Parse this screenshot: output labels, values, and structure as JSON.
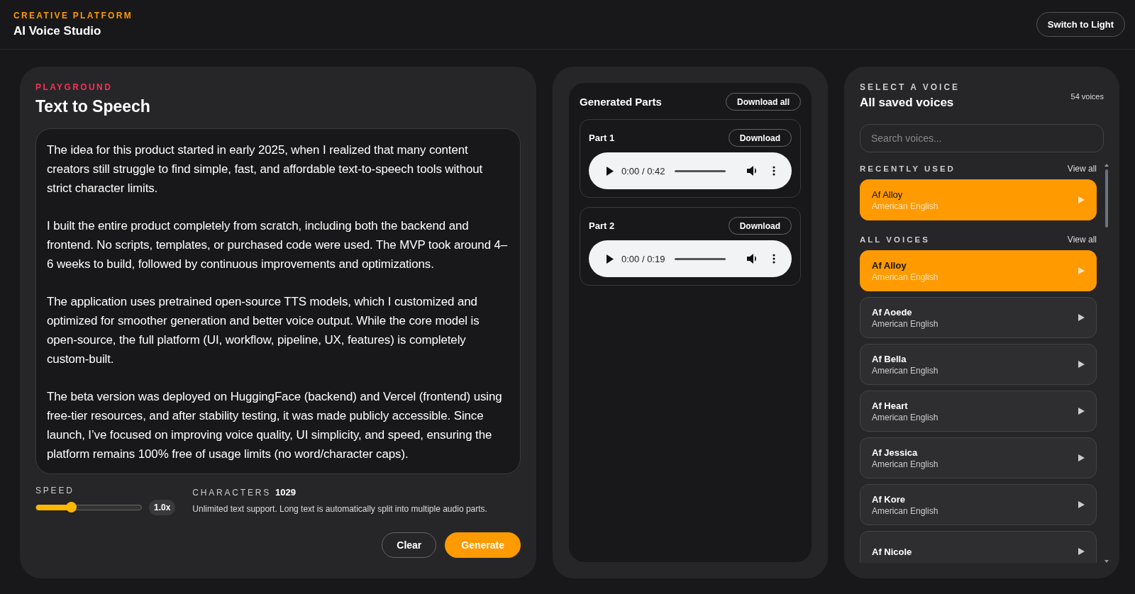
{
  "header": {
    "eyebrow": "CREATIVE PLATFORM",
    "title": "AI Voice Studio",
    "theme_button": "Switch to Light"
  },
  "playground": {
    "eyebrow": "PLAYGROUND",
    "title": "Text to Speech",
    "text": "The idea for this product started in early 2025, when I realized that many content creators still struggle to find simple, fast, and affordable text-to-speech tools without strict character limits.\n\nI built the entire product completely from scratch, including both the backend and frontend. No scripts, templates, or purchased code were used. The MVP took around 4–6 weeks to build, followed by continuous improvements and optimizations.\n\nThe application uses pretrained open-source TTS models, which I customized and optimized for smoother generation and better voice output. While the core model is open-source, the full platform (UI, workflow, pipeline, UX, features) is completely custom-built.\n\nThe beta version was deployed on HuggingFace (backend) and Vercel (frontend) using free-tier resources, and after stability testing, it was made publicly accessible. Since launch, I’ve focused on improving voice quality, UI simplicity, and speed, ensuring the platform remains 100% free of usage limits (no word/character caps).",
    "speed": {
      "label": "SPEED",
      "level": 0.34,
      "reading": "1.0x"
    },
    "characters": {
      "label": "CHARACTERS",
      "count": "1029",
      "note": "Unlimited text support. Long text is automatically split into multiple audio parts."
    },
    "buttons": [
      {
        "label": "Clear",
        "kind": "secondary"
      },
      {
        "label": "Generate",
        "kind": "primary"
      }
    ]
  },
  "parts": {
    "title": "Generated Parts",
    "download_all": "Download all",
    "items": [
      {
        "title": "Part 1",
        "button": "Download",
        "time": "0:00 / 0:42"
      },
      {
        "title": "Part 2",
        "button": "Download",
        "time": "0:00 / 0:19"
      }
    ]
  },
  "voices": {
    "eyebrow": "SELECT A VOICE",
    "title": "All saved voices",
    "count": "54 voices",
    "search": {
      "placeholder": "Search voices..."
    },
    "sections": [
      {
        "label": "RECENTLY USED",
        "link": "View all",
        "items": [
          {
            "name": "Af Alloy",
            "language": "American English",
            "selected": true
          }
        ]
      },
      {
        "label": "ALL VOICES",
        "link": "View all",
        "items": [
          {
            "name": "Af Alloy",
            "language": "American English",
            "selected": true
          },
          {
            "name": "Af Aoede",
            "language": "American English",
            "selected": false
          },
          {
            "name": "Af Bella",
            "language": "American English",
            "selected": false
          },
          {
            "name": "Af Heart",
            "language": "American English",
            "selected": false
          },
          {
            "name": "Af Jessica",
            "language": "American English",
            "selected": false
          },
          {
            "name": "Af Kore",
            "language": "American English",
            "selected": false
          },
          {
            "name": "Af Nicole",
            "selected": false
          }
        ]
      }
    ]
  }
}
